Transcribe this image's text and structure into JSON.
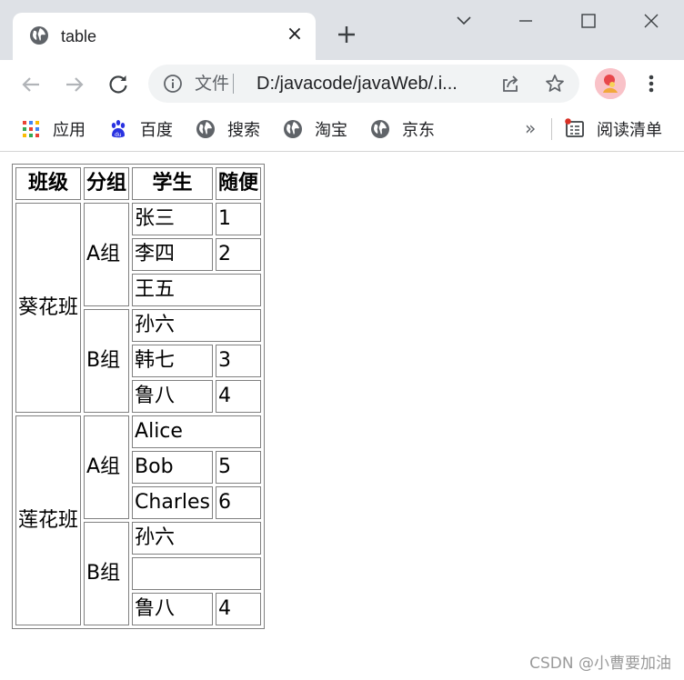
{
  "browser": {
    "tab_title": "table",
    "tab_close": "×",
    "security_label": "文件",
    "url": "D:/javacode/javaWeb/.i...",
    "bookmarks": [
      {
        "label": "应用",
        "icon": "apps-grid-icon"
      },
      {
        "label": "百度",
        "icon": "baidu-paw-icon"
      },
      {
        "label": "搜索",
        "icon": "globe-icon"
      },
      {
        "label": "淘宝",
        "icon": "globe-icon"
      },
      {
        "label": "京东",
        "icon": "globe-icon"
      }
    ],
    "more_bookmarks": "»",
    "reading_list": "阅读清单"
  },
  "table": {
    "headers": [
      "班级",
      "分组",
      "学生",
      "随便"
    ],
    "classes": [
      {
        "name": "葵花班",
        "groups": [
          {
            "name": "A组",
            "rows": [
              {
                "student": "张三",
                "note": "1"
              },
              {
                "student": "李四",
                "note": "2"
              },
              {
                "student": "王五"
              }
            ]
          },
          {
            "name": "B组",
            "rows": [
              {
                "student": "孙六"
              },
              {
                "student": "韩七",
                "note": "3"
              },
              {
                "student": "鲁八",
                "note": "4"
              }
            ]
          }
        ]
      },
      {
        "name": "莲花班",
        "groups": [
          {
            "name": "A组",
            "rows": [
              {
                "student": "Alice"
              },
              {
                "student": "Bob",
                "note": "5"
              },
              {
                "student": "Charles",
                "note": "6"
              }
            ]
          },
          {
            "name": "B组",
            "rows": [
              {
                "student": "孙六"
              },
              {
                "student": ""
              },
              {
                "student": "鲁八",
                "note": "4"
              }
            ]
          }
        ]
      }
    ]
  },
  "watermark": "CSDN @小曹要加油"
}
